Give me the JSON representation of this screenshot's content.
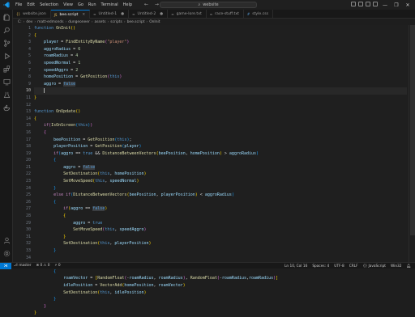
{
  "titlebar": {
    "menu": [
      "File",
      "Edit",
      "Selection",
      "View",
      "Go",
      "Run",
      "Terminal",
      "Help"
    ],
    "search": "website",
    "controls": [
      "—",
      "❐",
      "✕"
    ]
  },
  "tabs": [
    {
      "label": "website.json",
      "active": false
    },
    {
      "label": "bee.script",
      "active": true
    },
    {
      "label": "Untitled-1",
      "active": false
    },
    {
      "label": "Untitled-2",
      "active": false
    },
    {
      "label": "game-lore.txt",
      "active": false
    },
    {
      "label": "race-stuff.txt",
      "active": false
    },
    {
      "label": "style.css",
      "active": false
    }
  ],
  "breadcrumb": [
    "C:",
    "dev",
    "matt-edmonds",
    "dungeoneer",
    "assets",
    "scripts",
    "bee.script",
    "OnInit"
  ],
  "editor": {
    "line_numbers": [
      "1",
      "2",
      "3",
      "4",
      "5",
      "6",
      "7",
      "8",
      "9",
      "10",
      "11",
      "12",
      "13",
      "14",
      "15",
      "16",
      "17",
      "18",
      "19",
      "20",
      "21",
      "22",
      "23",
      "24",
      "25",
      "26",
      "27",
      "28",
      "29",
      "30",
      "31",
      "32",
      "33",
      "34"
    ],
    "current_line": 10
  },
  "status": {
    "left": [
      "master",
      "⊗ 0  ⚠ 0",
      "⚡ 0"
    ],
    "right": [
      "Ln 10, Col 16",
      "Spaces: 4",
      "UTF-8",
      "CRLF",
      "{} JavaScript",
      "Win32"
    ]
  },
  "colors": {
    "accent": "#0078d4",
    "keyword": "#569cd6",
    "function": "#dcdcaa",
    "variable": "#9cdcfe",
    "string": "#ce9178",
    "number": "#b5cea8"
  },
  "icons": [
    "explorer-icon",
    "search-icon",
    "source-control-icon",
    "run-debug-icon",
    "extensions-icon",
    "remote-icon",
    "testing-icon",
    "docker-icon",
    "accounts-icon",
    "settings-icon"
  ]
}
